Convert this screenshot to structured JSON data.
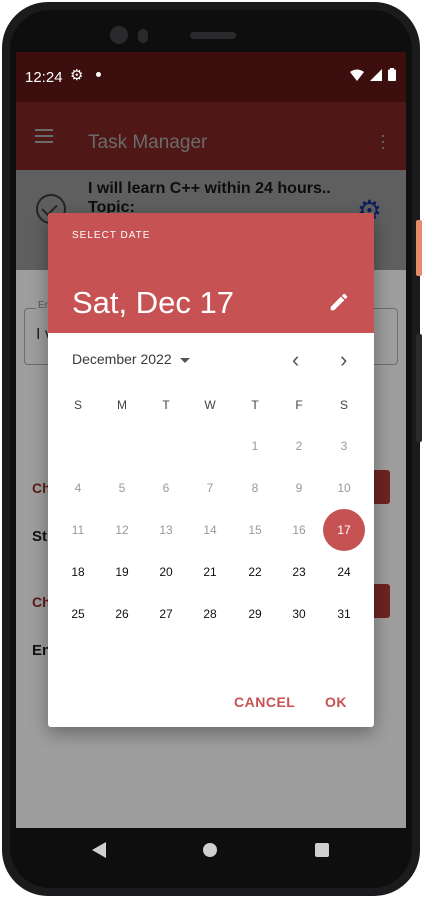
{
  "status_bar": {
    "time": "12:24"
  },
  "app_bar": {
    "title": "Task Manager"
  },
  "task": {
    "title": "I will learn C++ within 24 hours..",
    "topic": "Topic:"
  },
  "background": {
    "field_label": "En",
    "field_value": "I v",
    "section1_text": "Ch",
    "section1_label": "St",
    "section2_text": "Ch",
    "section2_label": "En"
  },
  "dialog": {
    "header_label": "SELECT DATE",
    "selected_date": "Sat, Dec 17",
    "month_year": "December 2022",
    "weekdays": [
      "S",
      "M",
      "T",
      "W",
      "T",
      "F",
      "S"
    ],
    "weeks": [
      [
        "",
        "",
        "",
        "",
        "1",
        "2",
        "3"
      ],
      [
        "4",
        "5",
        "6",
        "7",
        "8",
        "9",
        "10"
      ],
      [
        "11",
        "12",
        "13",
        "14",
        "15",
        "16",
        "17"
      ],
      [
        "18",
        "19",
        "20",
        "21",
        "22",
        "23",
        "24"
      ],
      [
        "25",
        "26",
        "27",
        "28",
        "29",
        "30",
        "31"
      ]
    ],
    "disabled_through": 16,
    "selected_day": "17",
    "cancel_label": "CANCEL",
    "ok_label": "OK"
  },
  "colors": {
    "accent": "#c75253",
    "status_bar": "#3c0e0d",
    "scrim": "#9e9e9e"
  }
}
